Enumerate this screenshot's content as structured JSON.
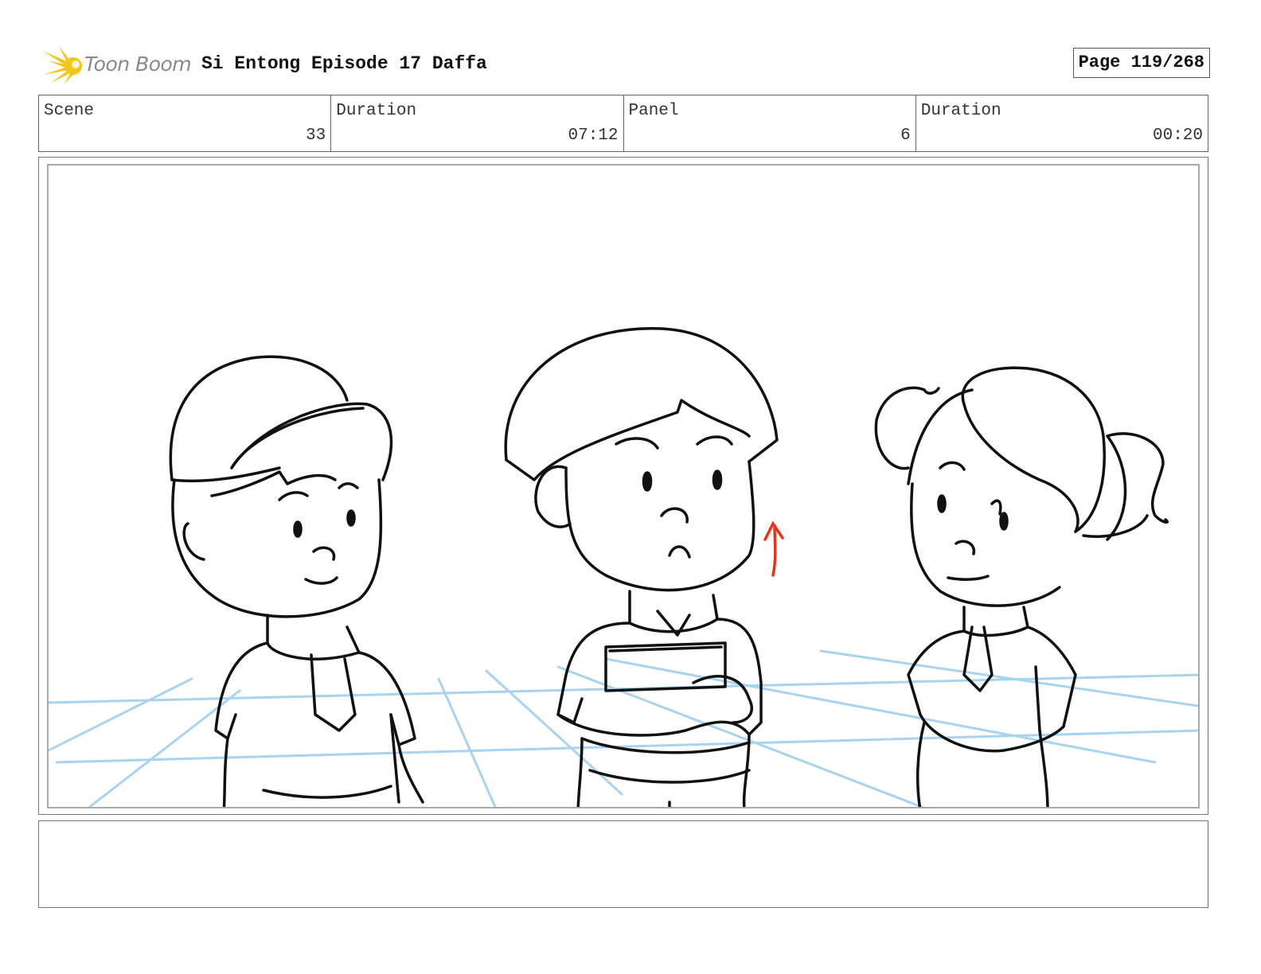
{
  "header": {
    "logo_text": "Toon Boom",
    "title": "Si Entong Episode 17 Daffa",
    "page": "Page 119/268"
  },
  "info": {
    "scene_label": "Scene",
    "scene_value": "33",
    "scene_duration_label": "Duration",
    "scene_duration_value": "07:12",
    "panel_label": "Panel",
    "panel_value": "6",
    "panel_duration_label": "Duration",
    "panel_duration_value": "00:20"
  },
  "notes": {
    "text": ""
  },
  "colors": {
    "logo_yellow": "#f5c518",
    "grid_blue": "#a9d4ef",
    "annotation_red": "#e8321a",
    "ink": "#111111"
  },
  "icons": {
    "logo": "toon-boom-star-icon",
    "arrow": "red-up-arrow"
  }
}
